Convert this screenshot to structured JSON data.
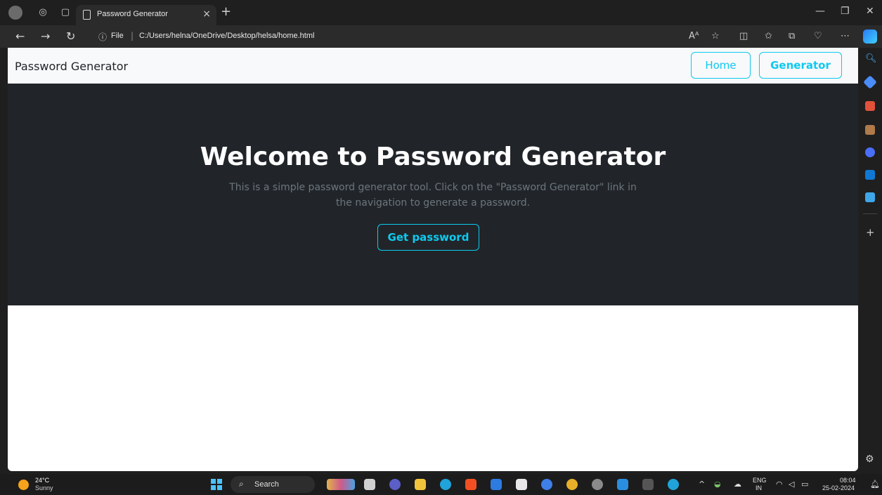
{
  "browser": {
    "tab_title": "Password Generator",
    "tab_close": "×",
    "new_tab": "+",
    "file_label": "File",
    "separator": "|",
    "url": "C:/Users/helna/OneDrive/Desktop/helsa/home.html"
  },
  "site": {
    "brand": "Password Generator",
    "nav": {
      "home": "Home",
      "generator": "Generator"
    },
    "hero": {
      "title": "Welcome to Password Generator",
      "description": "This is a simple password generator tool. Click on the \"Password Generator\" link in the navigation to generate a password.",
      "button": "Get password"
    },
    "colors": {
      "accent": "#0dcaf0",
      "hero_bg": "#212529",
      "nav_bg": "#f8f9fa"
    }
  },
  "taskbar": {
    "weather_temp": "24°C",
    "weather_condition": "Sunny",
    "search_label": "Search",
    "lang_top": "ENG",
    "lang_bottom": "IN",
    "time": "08:04",
    "date": "25-02-2024"
  }
}
